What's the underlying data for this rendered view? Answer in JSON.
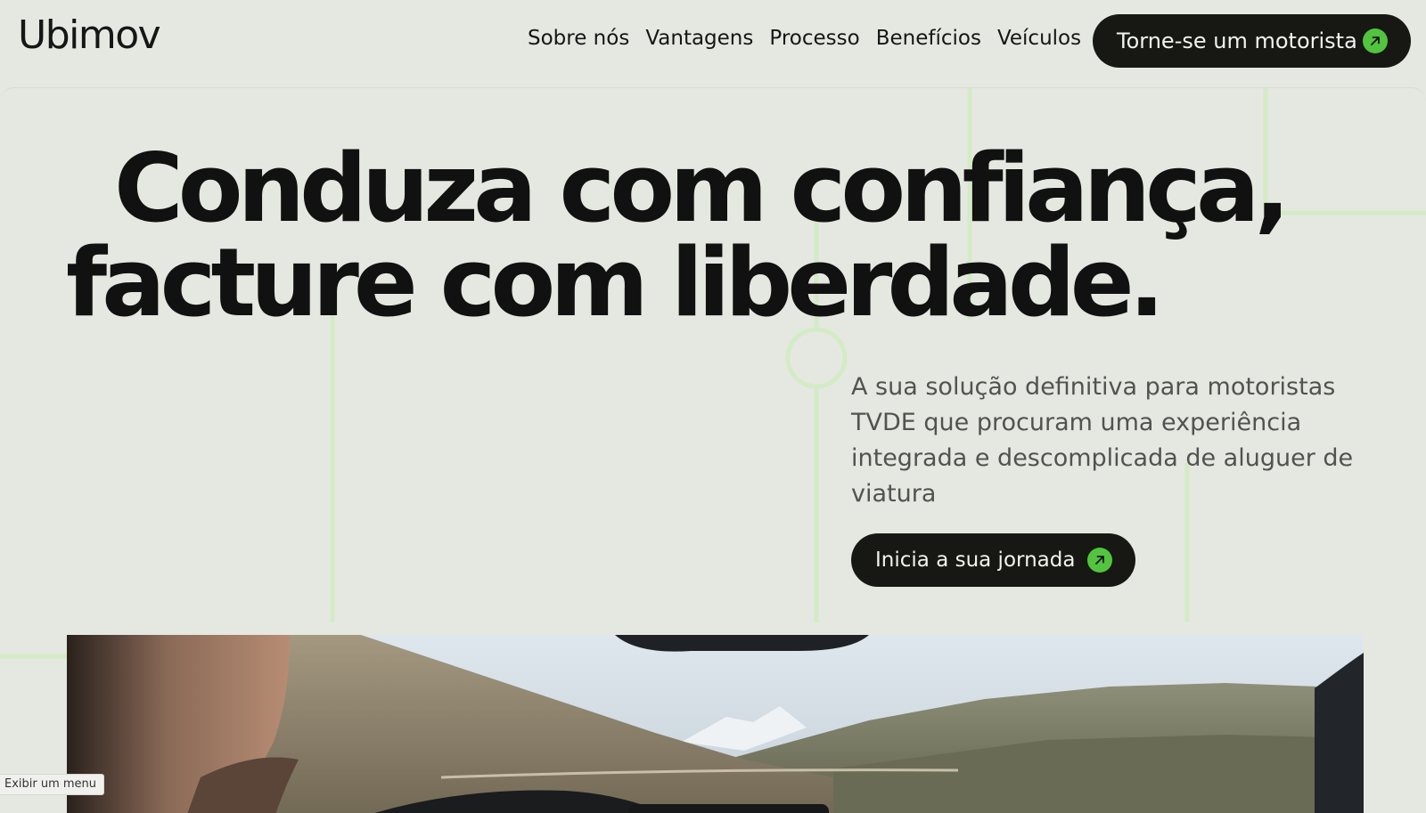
{
  "header": {
    "logo": "Ubimov",
    "nav": [
      {
        "label": "Sobre nós"
      },
      {
        "label": "Vantagens"
      },
      {
        "label": "Processo"
      },
      {
        "label": "Benefícios"
      },
      {
        "label": "Veículos"
      }
    ],
    "cta": {
      "label": "Torne-se um motorista",
      "icon": "arrow-up-right-icon"
    }
  },
  "hero": {
    "headline_line1": "Conduza com confiança,",
    "headline_line2": "facture com liberdade.",
    "subtitle": "A sua solução definitiva para motoristas TVDE que procuram uma experiência integrada e descomplicada de aluguer de viatura",
    "cta": {
      "label": "Inicia a sua jornada",
      "icon": "arrow-up-right-icon"
    }
  },
  "status_tooltip": "Exibir um menu",
  "colors": {
    "background": "#e5e8e0",
    "button_dark": "#171814",
    "accent_green": "#52c43f",
    "deco_lines": "#d3ebc6",
    "text_muted": "#505350"
  }
}
